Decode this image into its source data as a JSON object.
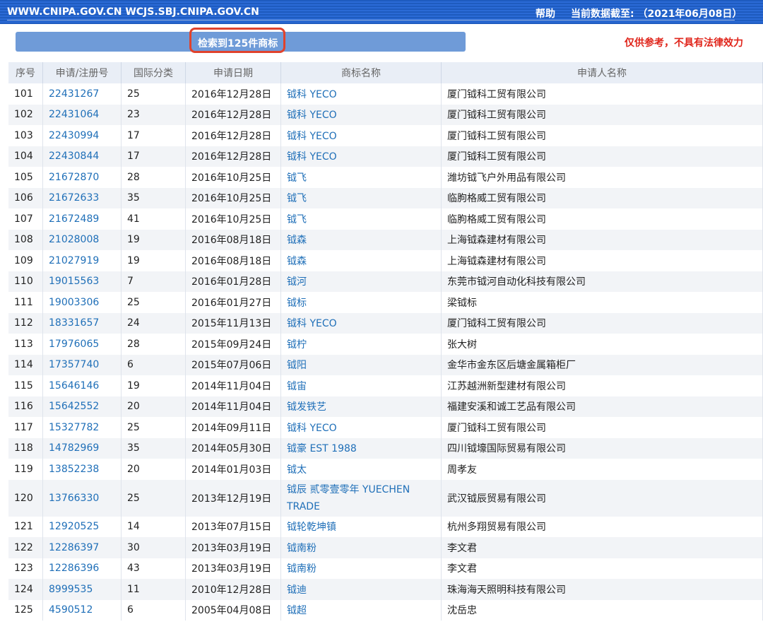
{
  "header": {
    "site_text": "WWW.CNIPA.GOV.CN WCJS.SBJ.CNIPA.GOV.CN",
    "help_label": "帮助",
    "data_date": "当前数据截至: （2021年06月08日）"
  },
  "summary": {
    "count_text": "检索到125件商标",
    "disclaimer": "仅供参考，不具有法律效力"
  },
  "table": {
    "columns": [
      "序号",
      "申请/注册号",
      "国际分类",
      "申请日期",
      "商标名称",
      "申请人名称"
    ],
    "rows": [
      {
        "no": "101",
        "reg": "22431267",
        "cls": "25",
        "date": "2016年12月28日",
        "mark": "钺科 YECO",
        "applicant": "厦门钺科工贸有限公司"
      },
      {
        "no": "102",
        "reg": "22431064",
        "cls": "23",
        "date": "2016年12月28日",
        "mark": "钺科 YECO",
        "applicant": "厦门钺科工贸有限公司"
      },
      {
        "no": "103",
        "reg": "22430994",
        "cls": "17",
        "date": "2016年12月28日",
        "mark": "钺科 YECO",
        "applicant": "厦门钺科工贸有限公司"
      },
      {
        "no": "104",
        "reg": "22430844",
        "cls": "17",
        "date": "2016年12月28日",
        "mark": "钺科 YECO",
        "applicant": "厦门钺科工贸有限公司"
      },
      {
        "no": "105",
        "reg": "21672870",
        "cls": "28",
        "date": "2016年10月25日",
        "mark": "钺飞",
        "applicant": "潍坊钺飞户外用品有限公司"
      },
      {
        "no": "106",
        "reg": "21672633",
        "cls": "35",
        "date": "2016年10月25日",
        "mark": "钺飞",
        "applicant": "临朐格威工贸有限公司"
      },
      {
        "no": "107",
        "reg": "21672489",
        "cls": "41",
        "date": "2016年10月25日",
        "mark": "钺飞",
        "applicant": "临朐格威工贸有限公司"
      },
      {
        "no": "108",
        "reg": "21028008",
        "cls": "19",
        "date": "2016年08月18日",
        "mark": "钺森",
        "applicant": "上海钺森建材有限公司"
      },
      {
        "no": "109",
        "reg": "21027919",
        "cls": "19",
        "date": "2016年08月18日",
        "mark": "钺森",
        "applicant": "上海钺森建材有限公司"
      },
      {
        "no": "110",
        "reg": "19015563",
        "cls": "7",
        "date": "2016年01月28日",
        "mark": "钺河",
        "applicant": "东莞市钺河自动化科技有限公司"
      },
      {
        "no": "111",
        "reg": "19003306",
        "cls": "25",
        "date": "2016年01月27日",
        "mark": "钺标",
        "applicant": "梁钺标"
      },
      {
        "no": "112",
        "reg": "18331657",
        "cls": "24",
        "date": "2015年11月13日",
        "mark": "钺科 YECO",
        "applicant": "厦门钺科工贸有限公司"
      },
      {
        "no": "113",
        "reg": "17976065",
        "cls": "28",
        "date": "2015年09月24日",
        "mark": "钺柠",
        "applicant": "张大树"
      },
      {
        "no": "114",
        "reg": "17357740",
        "cls": "6",
        "date": "2015年07月06日",
        "mark": "钺阳",
        "applicant": "金华市金东区后塘金属箱柜厂"
      },
      {
        "no": "115",
        "reg": "15646146",
        "cls": "19",
        "date": "2014年11月04日",
        "mark": "钺宙",
        "applicant": "江苏越洲新型建材有限公司"
      },
      {
        "no": "116",
        "reg": "15642552",
        "cls": "20",
        "date": "2014年11月04日",
        "mark": "钺发铁艺",
        "applicant": "福建安溪和诚工艺品有限公司"
      },
      {
        "no": "117",
        "reg": "15327782",
        "cls": "25",
        "date": "2014年09月11日",
        "mark": "钺科 YECO",
        "applicant": "厦门钺科工贸有限公司"
      },
      {
        "no": "118",
        "reg": "14782969",
        "cls": "35",
        "date": "2014年05月30日",
        "mark": "钺豪 EST 1988",
        "applicant": "四川钺壕国际贸易有限公司"
      },
      {
        "no": "119",
        "reg": "13852238",
        "cls": "20",
        "date": "2014年01月03日",
        "mark": "钺太",
        "applicant": "周孝友"
      },
      {
        "no": "120",
        "reg": "13766330",
        "cls": "25",
        "date": "2013年12月19日",
        "mark": "钺辰 贰零壹零年 YUECHEN TRADE",
        "applicant": "武汉钺辰贸易有限公司"
      },
      {
        "no": "121",
        "reg": "12920525",
        "cls": "14",
        "date": "2013年07月15日",
        "mark": "钺轮乾坤镇",
        "applicant": "杭州多翔贸易有限公司"
      },
      {
        "no": "122",
        "reg": "12286397",
        "cls": "30",
        "date": "2013年03月19日",
        "mark": "钺南粉",
        "applicant": "李文君"
      },
      {
        "no": "123",
        "reg": "12286396",
        "cls": "43",
        "date": "2013年03月19日",
        "mark": "钺南粉",
        "applicant": "李文君"
      },
      {
        "no": "124",
        "reg": "8999535",
        "cls": "11",
        "date": "2010年12月28日",
        "mark": "钺迪",
        "applicant": "珠海海天照明科技有限公司"
      },
      {
        "no": "125",
        "reg": "4590512",
        "cls": "6",
        "date": "2005年04月08日",
        "mark": "钺超",
        "applicant": "沈岳忠"
      }
    ]
  }
}
